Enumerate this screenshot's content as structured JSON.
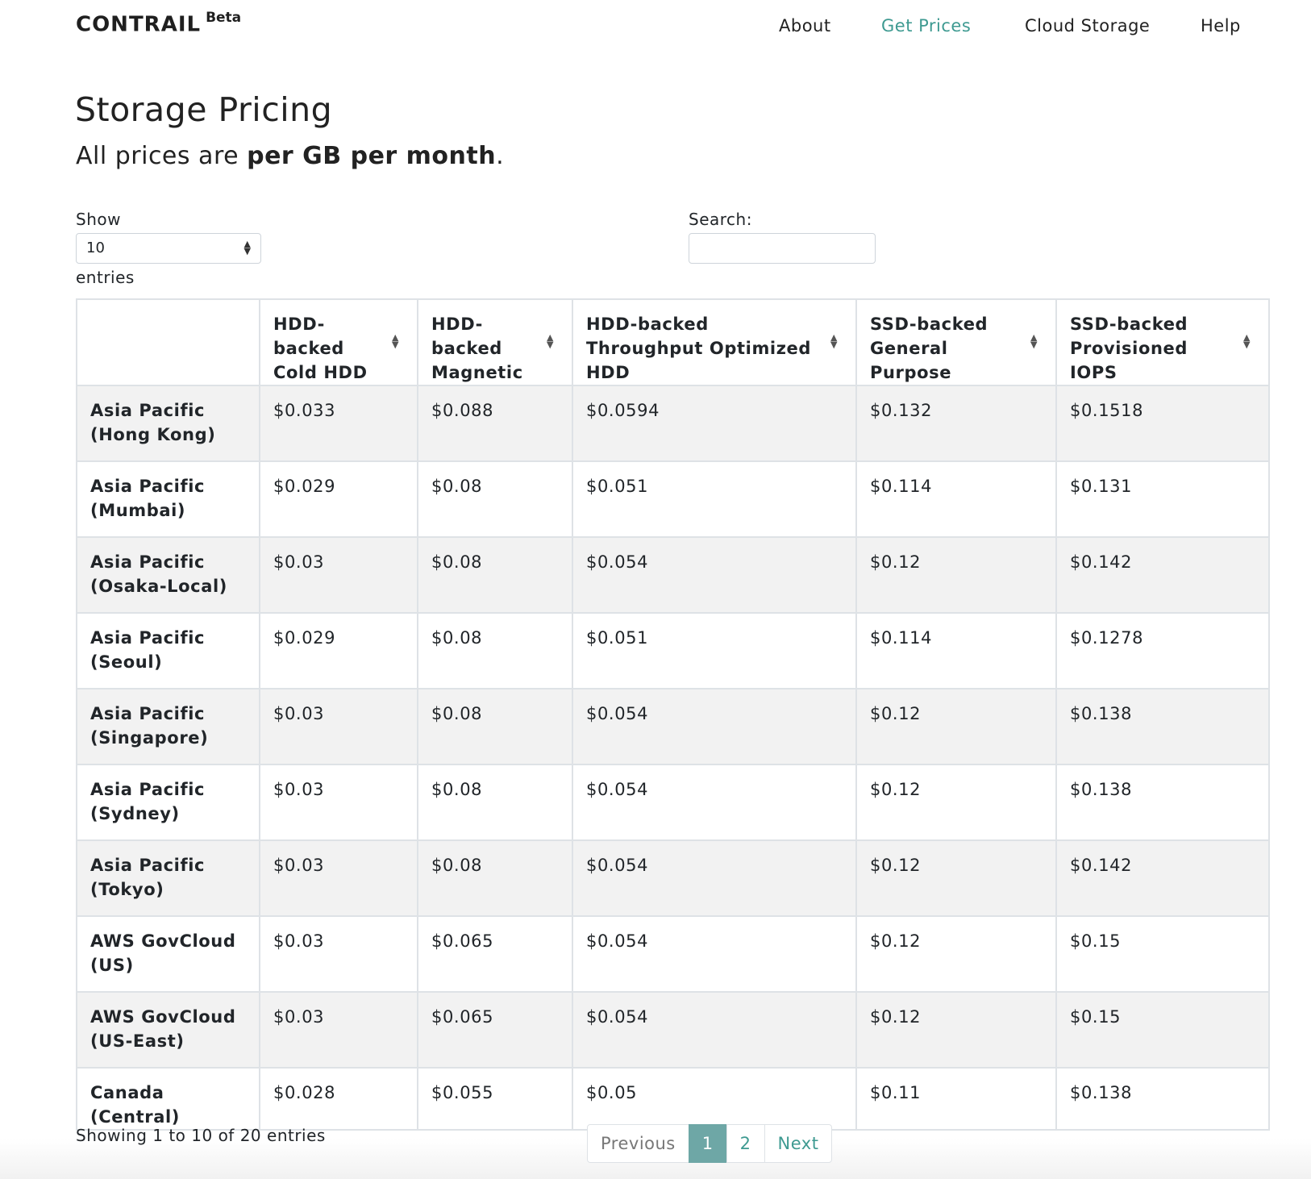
{
  "nav": {
    "brand": "CONTRAIL",
    "brand_badge": "Beta",
    "links": [
      {
        "label": "About"
      },
      {
        "label": "Get Prices"
      },
      {
        "label": "Cloud Storage"
      },
      {
        "label": "Help"
      }
    ],
    "active_link": "Get Prices",
    "accent_color": "#3e9a91"
  },
  "page": {
    "title": "Storage Pricing",
    "subtitle_prefix": "All prices are ",
    "subtitle_bold": "per GB per month",
    "subtitle_suffix": "."
  },
  "controls": {
    "show_label": "Show",
    "page_size": "10",
    "entries_label": "entries",
    "search_label": "Search:",
    "search_value": ""
  },
  "table": {
    "headers": [
      "",
      "HDD-backed Cold HDD",
      "HDD-backed Magnetic",
      "HDD-backed Throughput Optimized HDD",
      "SSD-backed General Purpose",
      "SSD-backed Provisioned IOPS"
    ],
    "rows": [
      {
        "region": "Asia Pacific (Hong Kong)",
        "values": [
          "$0.033",
          "$0.088",
          "$0.0594",
          "$0.132",
          "$0.1518"
        ]
      },
      {
        "region": "Asia Pacific (Mumbai)",
        "values": [
          "$0.029",
          "$0.08",
          "$0.051",
          "$0.114",
          "$0.131"
        ]
      },
      {
        "region": "Asia Pacific (Osaka-Local)",
        "values": [
          "$0.03",
          "$0.08",
          "$0.054",
          "$0.12",
          "$0.142"
        ]
      },
      {
        "region": "Asia Pacific (Seoul)",
        "values": [
          "$0.029",
          "$0.08",
          "$0.051",
          "$0.114",
          "$0.1278"
        ]
      },
      {
        "region": "Asia Pacific (Singapore)",
        "values": [
          "$0.03",
          "$0.08",
          "$0.054",
          "$0.12",
          "$0.138"
        ]
      },
      {
        "region": "Asia Pacific (Sydney)",
        "values": [
          "$0.03",
          "$0.08",
          "$0.054",
          "$0.12",
          "$0.138"
        ]
      },
      {
        "region": "Asia Pacific (Tokyo)",
        "values": [
          "$0.03",
          "$0.08",
          "$0.054",
          "$0.12",
          "$0.142"
        ]
      },
      {
        "region": "AWS GovCloud (US)",
        "values": [
          "$0.03",
          "$0.065",
          "$0.054",
          "$0.12",
          "$0.15"
        ]
      },
      {
        "region": "AWS GovCloud (US-East)",
        "values": [
          "$0.03",
          "$0.065",
          "$0.054",
          "$0.12",
          "$0.15"
        ]
      },
      {
        "region": "Canada (Central)",
        "values": [
          "$0.028",
          "$0.055",
          "$0.05",
          "$0.11",
          "$0.138"
        ]
      }
    ]
  },
  "footer": {
    "info": "Showing 1 to 10 of 20 entries",
    "pagination": {
      "previous": "Previous",
      "pages": [
        "1",
        "2"
      ],
      "current": "1",
      "next": "Next",
      "current_bg": "#6ea7a6"
    }
  },
  "icons": {
    "sort": "sort-updown-icon",
    "select_arrow": "select-updown-icon"
  }
}
